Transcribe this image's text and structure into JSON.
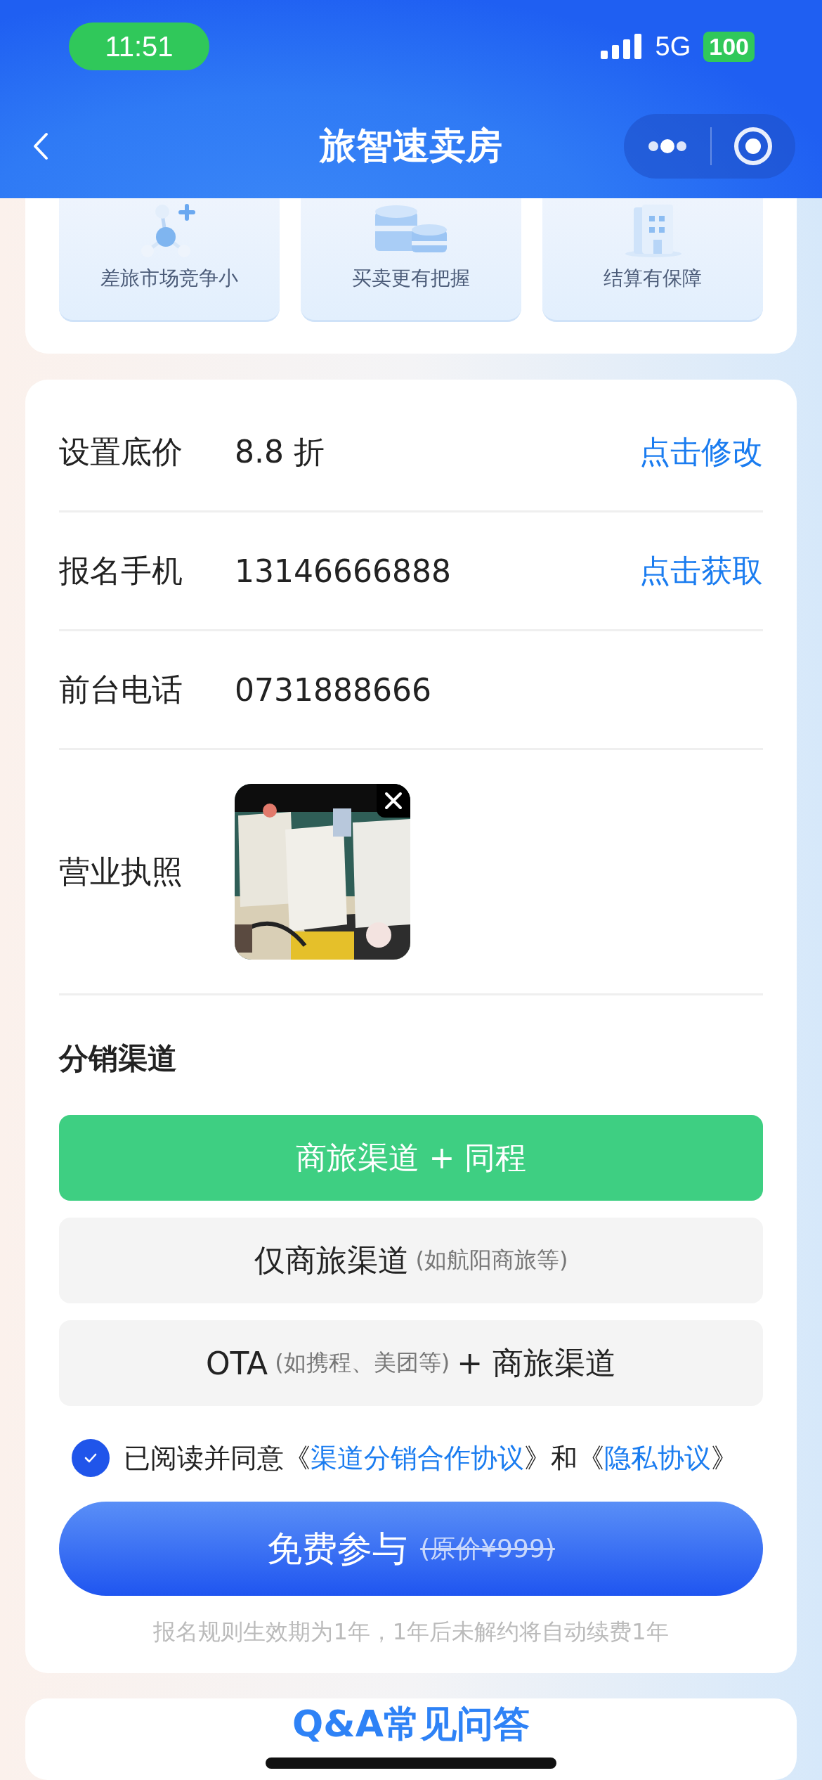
{
  "status_bar": {
    "time": "11:51",
    "network": "5G",
    "battery": "100"
  },
  "nav": {
    "title": "旅智速卖房"
  },
  "features": [
    {
      "kind": "molecule",
      "label": "差旅市场竞争小"
    },
    {
      "kind": "coins",
      "label": "买卖更有把握"
    },
    {
      "kind": "building",
      "label": "结算有保障"
    }
  ],
  "form": {
    "rows": [
      {
        "kind": "text",
        "label": "设置底价",
        "value": "8.8 折",
        "action": "点击修改"
      },
      {
        "kind": "text",
        "label": "报名手机",
        "value": "13146666888",
        "action": "点击获取"
      },
      {
        "kind": "text",
        "label": "前台电话",
        "value": "0731888666"
      },
      {
        "label": "营业执照"
      }
    ],
    "channels_title": "分销渠道",
    "channels": [
      {
        "selected": true,
        "parts": [
          {
            "kind": "main",
            "text": "商旅渠道 + 同程"
          }
        ]
      },
      {
        "selected": false,
        "parts": [
          {
            "kind": "main",
            "text": "仅商旅渠道"
          },
          {
            "kind": "note",
            "text": "(如航阳商旅等)"
          }
        ]
      },
      {
        "selected": false,
        "parts": [
          {
            "kind": "main",
            "text": "OTA"
          },
          {
            "kind": "note",
            "text": "(如携程、美团等)"
          },
          {
            "kind": "main",
            "text": "+ 商旅渠道"
          }
        ]
      }
    ],
    "agreement": {
      "checked": true,
      "parts": [
        {
          "kind": "text",
          "text": "已阅读并同意《"
        },
        {
          "kind": "link",
          "text": "渠道分销合作协议"
        },
        {
          "kind": "text",
          "text": "》和《"
        },
        {
          "kind": "link",
          "text": "隐私协议"
        },
        {
          "kind": "text",
          "text": "》"
        }
      ]
    },
    "submit": {
      "label": "免费参与",
      "original_price": "(原价¥999)"
    },
    "note": "报名规则生效期为1年，1年后未解约将自动续费1年"
  },
  "faq": {
    "title": "Q&A常见问答"
  }
}
